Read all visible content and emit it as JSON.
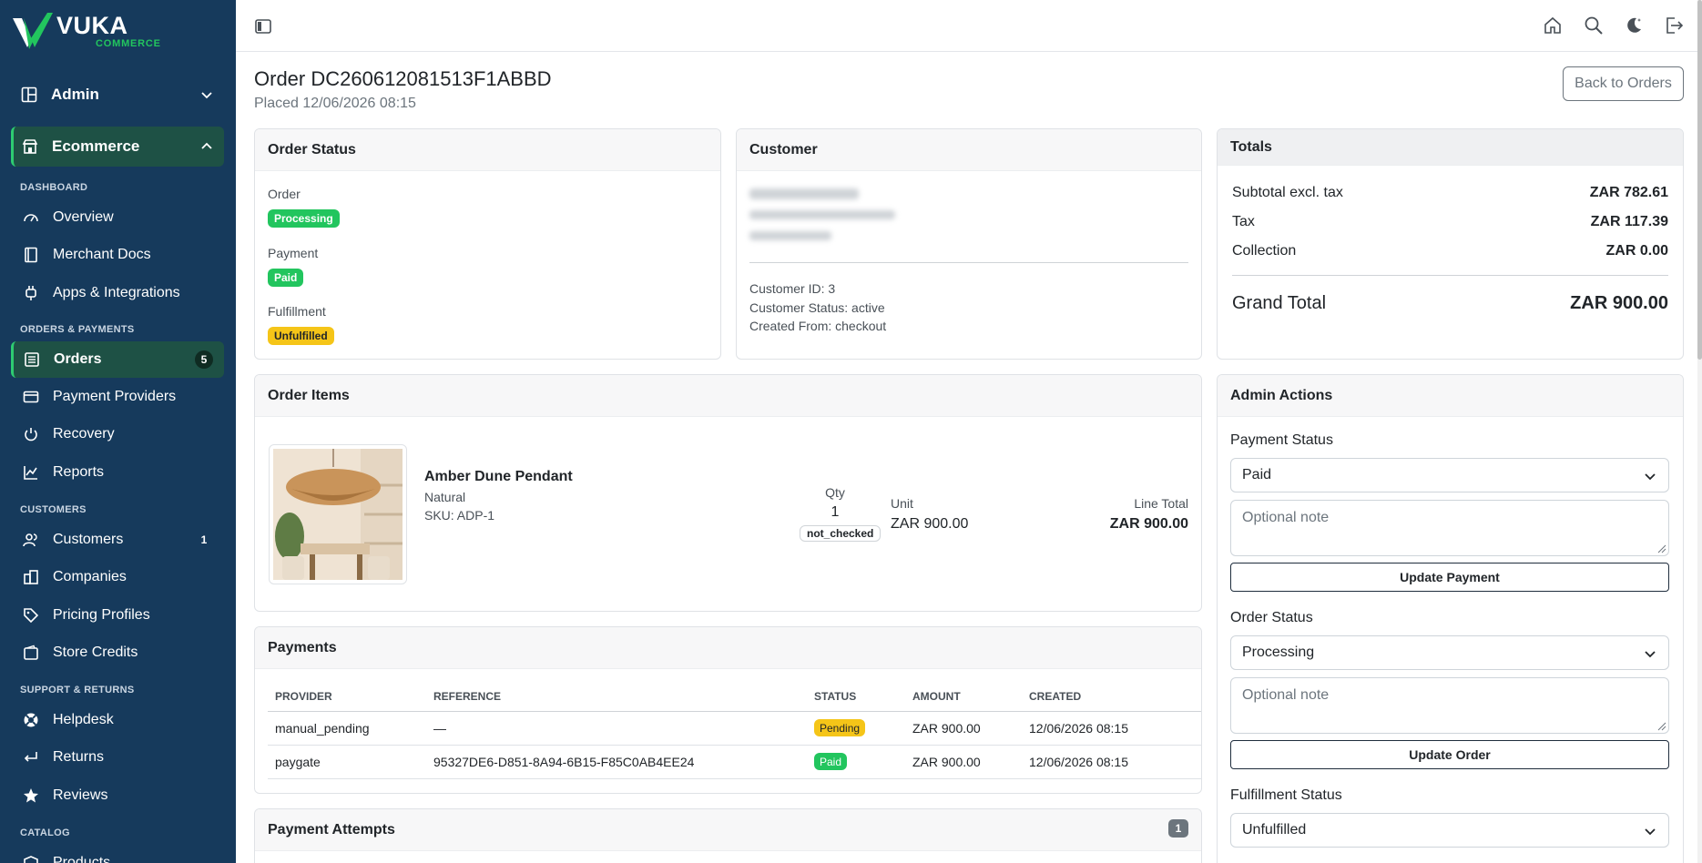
{
  "brand": {
    "name": "VUKA",
    "tagline": "COMMERCE"
  },
  "sidebar": {
    "groups": [
      {
        "label": "Admin"
      },
      {
        "label": "Ecommerce"
      }
    ],
    "sections": [
      "DASHBOARD",
      "ORDERS & PAYMENTS",
      "CUSTOMERS",
      "SUPPORT & RETURNS",
      "CATALOG"
    ],
    "items": [
      {
        "label": "Overview",
        "icon": "gauge-icon"
      },
      {
        "label": "Merchant Docs",
        "icon": "book-icon"
      },
      {
        "label": "Apps & Integrations",
        "icon": "plug-icon"
      },
      {
        "label": "Orders",
        "icon": "receipt-icon",
        "badge": "5"
      },
      {
        "label": "Payment Providers",
        "icon": "credit-card-icon"
      },
      {
        "label": "Recovery",
        "icon": "power-icon"
      },
      {
        "label": "Reports",
        "icon": "chart-line-icon"
      },
      {
        "label": "Customers",
        "icon": "users-icon",
        "badge": "1"
      },
      {
        "label": "Companies",
        "icon": "buildings-icon"
      },
      {
        "label": "Pricing Profiles",
        "icon": "tag-icon"
      },
      {
        "label": "Store Credits",
        "icon": "wallet-icon"
      },
      {
        "label": "Helpdesk",
        "icon": "lifebuoy-icon"
      },
      {
        "label": "Returns",
        "icon": "return-arrow-icon"
      },
      {
        "label": "Reviews",
        "icon": "star-icon"
      },
      {
        "label": "Products",
        "icon": "box-icon"
      }
    ]
  },
  "header": {
    "title": "Order DC260612081513F1ABBD",
    "placed": "Placed 12/06/2026 08:15",
    "back_label": "Back to Orders"
  },
  "order_status": {
    "title": "Order Status",
    "order_label": "Order",
    "order_value": "Processing",
    "payment_label": "Payment",
    "payment_value": "Paid",
    "fulfillment_label": "Fulfillment",
    "fulfillment_value": "Unfulfilled"
  },
  "customer": {
    "title": "Customer",
    "id_line": "Customer ID: 3",
    "status_line": "Customer Status: active",
    "created_line": "Created From: checkout"
  },
  "totals": {
    "title": "Totals",
    "rows": [
      {
        "label": "Subtotal excl. tax",
        "value": "ZAR 782.61"
      },
      {
        "label": "Tax",
        "value": "ZAR 117.39"
      },
      {
        "label": "Collection",
        "value": "ZAR 0.00"
      }
    ],
    "grand_label": "Grand Total",
    "grand_value": "ZAR 900.00"
  },
  "order_items": {
    "title": "Order Items",
    "item": {
      "name": "Amber Dune Pendant",
      "variant": "Natural",
      "sku": "SKU: ADP-1",
      "qty_label": "Qty",
      "qty": "1",
      "stock": "not_checked",
      "unit_label": "Unit",
      "unit_value": "ZAR 900.00",
      "line_label": "Line Total",
      "line_value": "ZAR 900.00"
    }
  },
  "payments": {
    "title": "Payments",
    "columns": [
      "PROVIDER",
      "REFERENCE",
      "STATUS",
      "AMOUNT",
      "CREATED"
    ],
    "rows": [
      {
        "provider": "manual_pending",
        "reference": "—",
        "status": "Pending",
        "amount": "ZAR 900.00",
        "created": "12/06/2026 08:15"
      },
      {
        "provider": "paygate",
        "reference": "95327DE6-D851-8A94-6B15-F85C0AB4EE24",
        "status": "Paid",
        "amount": "ZAR 900.00",
        "created": "12/06/2026 08:15"
      }
    ]
  },
  "payment_attempts": {
    "title": "Payment Attempts",
    "count": "1"
  },
  "admin_actions": {
    "title": "Admin Actions",
    "payment_status_label": "Payment Status",
    "payment_status_value": "Paid",
    "note_placeholder": "Optional note",
    "update_payment": "Update Payment",
    "order_status_label": "Order Status",
    "order_status_value": "Processing",
    "update_order": "Update Order",
    "fulfillment_status_label": "Fulfillment Status",
    "fulfillment_status_value": "Unfulfilled"
  },
  "colors": {
    "sidebar_bg": "#163a5c",
    "accent_green": "#22c55e",
    "warning_yellow": "#f5c518"
  }
}
